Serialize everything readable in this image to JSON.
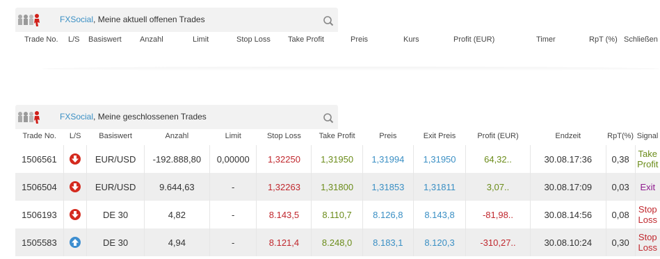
{
  "open_trades": {
    "brand": "FXSocial",
    "title": ", Meine aktuell offenen Trades",
    "columns": [
      "Trade No.",
      "L/S",
      "Basiswert",
      "Anzahl",
      "Limit",
      "Stop Loss",
      "Take Profit",
      "Preis",
      "Kurs",
      "Profit (EUR)",
      "Timer",
      "RpT (%)",
      "Schließen"
    ]
  },
  "closed_trades": {
    "brand": "FXSocial",
    "title": ", Meine geschlossenen Trades",
    "columns": [
      "Trade No.",
      "L/S",
      "Basiswert",
      "Anzahl",
      "Limit",
      "Stop Loss",
      "Take Profit",
      "Preis",
      "Exit Preis",
      "Profit (EUR)",
      "Endzeit",
      "RpT(%)",
      "Signal"
    ],
    "rows": [
      {
        "trade_no": "1506561",
        "direction": "down",
        "basiswert": "EUR/USD",
        "anzahl": "-192.888,80",
        "limit": "0,00000",
        "stop_loss": "1,32250",
        "take_profit": "1,31950",
        "preis": "1,31994",
        "exit_preis": "1,31950",
        "profit": "64,32..",
        "profit_color": "#6b8c1a",
        "endzeit": "30.08.17:36",
        "rpt": "0,38",
        "signal": "Take Profit",
        "signal_color": "#6b8c1a"
      },
      {
        "trade_no": "1506504",
        "direction": "down",
        "basiswert": "EUR/USD",
        "anzahl": "9.644,63",
        "limit": "-",
        "stop_loss": "1,32263",
        "take_profit": "1,31800",
        "preis": "1,31853",
        "exit_preis": "1,31811",
        "profit": "3,07..",
        "profit_color": "#6b8c1a",
        "endzeit": "30.08.17:09",
        "rpt": "0,03",
        "signal": "Exit",
        "signal_color": "#8e1a8e"
      },
      {
        "trade_no": "1506193",
        "direction": "down",
        "basiswert": "DE 30",
        "anzahl": "4,82",
        "limit": "-",
        "stop_loss": "8.143,5",
        "take_profit": "8.110,7",
        "preis": "8.126,8",
        "exit_preis": "8.143,8",
        "profit": "-81,98..",
        "profit_color": "#c0272d",
        "endzeit": "30.08.14:56",
        "rpt": "0,08",
        "signal": "Stop Loss",
        "signal_color": "#c0272d"
      },
      {
        "trade_no": "1505583",
        "direction": "up",
        "basiswert": "DE 30",
        "anzahl": "4,94",
        "limit": "-",
        "stop_loss": "8.121,4",
        "take_profit": "8.248,0",
        "preis": "8.183,1",
        "exit_preis": "8.120,3",
        "profit": "-310,27..",
        "profit_color": "#c0272d",
        "endzeit": "30.08.10:24",
        "rpt": "0,30",
        "signal": "Stop Loss",
        "signal_color": "#c0272d"
      }
    ]
  }
}
